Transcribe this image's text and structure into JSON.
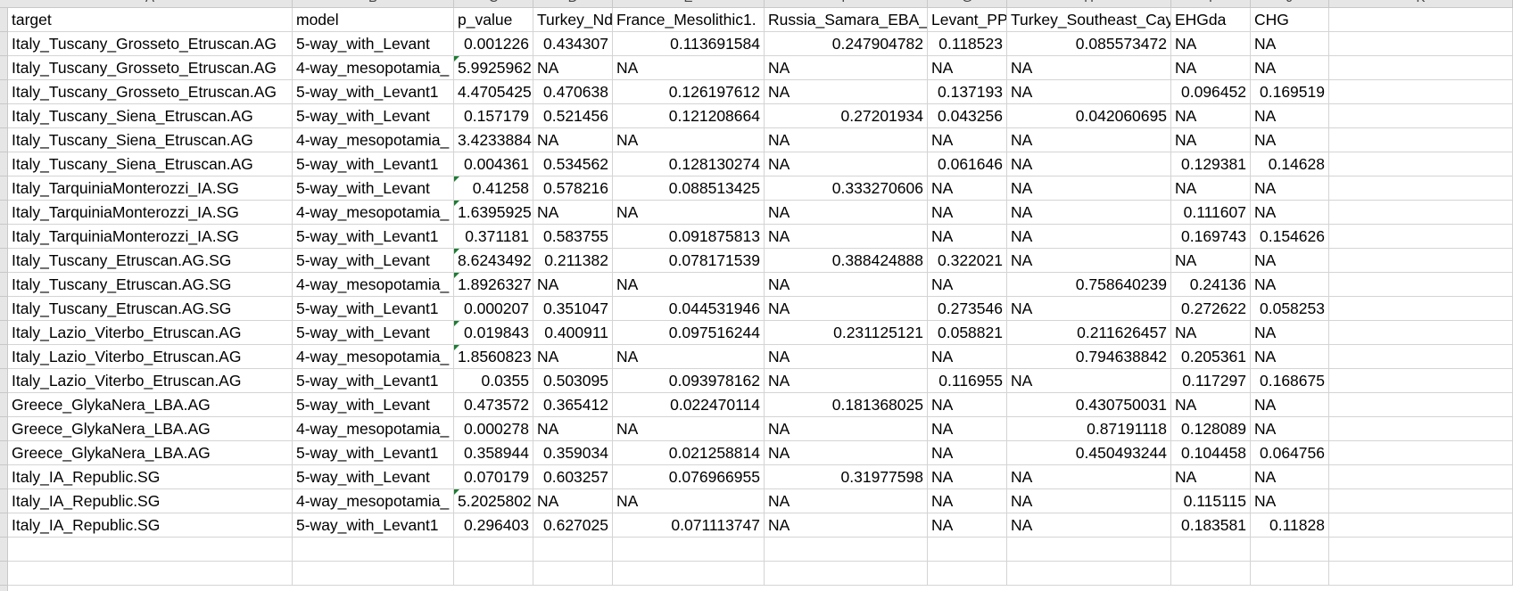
{
  "columns": [
    "A",
    "B",
    "C",
    "D",
    "E",
    "F",
    "G",
    "H",
    "I",
    "J",
    "K"
  ],
  "header_row": [
    "target",
    "model",
    "p_value",
    "Turkey_Nd",
    "France_Mesolithic1.",
    "Russia_Samara_EBA_\\",
    "Levant_PP",
    "Turkey_Southeast_Cay",
    "EHGda",
    "CHG",
    ""
  ],
  "rows": [
    [
      "Italy_Tuscany_Grosseto_Etruscan.AG",
      "5-way_with_Levant",
      "0.001226",
      "0.434307",
      "0.113691584",
      "0.247904782",
      "0.118523",
      "0.085573472",
      "NA",
      "NA"
    ],
    [
      "Italy_Tuscany_Grosseto_Etruscan.AG",
      "4-way_mesopotamia_",
      "5.9925962",
      "NA",
      "NA",
      "NA",
      "NA",
      "NA",
      "NA",
      "NA"
    ],
    [
      "Italy_Tuscany_Grosseto_Etruscan.AG",
      "5-way_with_Levant1",
      "4.4705425",
      "0.470638",
      "0.126197612",
      "NA",
      "0.137193",
      "NA",
      "0.096452",
      "0.169519"
    ],
    [
      "Italy_Tuscany_Siena_Etruscan.AG",
      "5-way_with_Levant",
      "0.157179",
      "0.521456",
      "0.121208664",
      "0.27201934",
      "0.043256",
      "0.042060695",
      "NA",
      "NA"
    ],
    [
      "Italy_Tuscany_Siena_Etruscan.AG",
      "4-way_mesopotamia_",
      "3.4233884",
      "NA",
      "NA",
      "NA",
      "NA",
      "NA",
      "NA",
      "NA"
    ],
    [
      "Italy_Tuscany_Siena_Etruscan.AG",
      "5-way_with_Levant1",
      "0.004361",
      "0.534562",
      "0.128130274",
      "NA",
      "0.061646",
      "NA",
      "0.129381",
      "0.14628"
    ],
    [
      "Italy_TarquiniaMonterozzi_IA.SG",
      "5-way_with_Levant",
      "0.41258",
      "0.578216",
      "0.088513425",
      "0.333270606",
      "NA",
      "NA",
      "NA",
      "NA"
    ],
    [
      "Italy_TarquiniaMonterozzi_IA.SG",
      "4-way_mesopotamia_",
      "1.6395925",
      "NA",
      "NA",
      "NA",
      "NA",
      "NA",
      "0.111607",
      "NA"
    ],
    [
      "Italy_TarquiniaMonterozzi_IA.SG",
      "5-way_with_Levant1",
      "0.371181",
      "0.583755",
      "0.091875813",
      "NA",
      "NA",
      "NA",
      "0.169743",
      "0.154626"
    ],
    [
      "Italy_Tuscany_Etruscan.AG.SG",
      "5-way_with_Levant",
      "8.6243492",
      "0.211382",
      "0.078171539",
      "0.388424888",
      "0.322021",
      "NA",
      "NA",
      "NA"
    ],
    [
      "Italy_Tuscany_Etruscan.AG.SG",
      "4-way_mesopotamia_",
      "1.8926327",
      "NA",
      "NA",
      "NA",
      "NA",
      "0.758640239",
      "0.24136",
      "NA"
    ],
    [
      "Italy_Tuscany_Etruscan.AG.SG",
      "5-way_with_Levant1",
      "0.000207",
      "0.351047",
      "0.044531946",
      "NA",
      "0.273546",
      "NA",
      "0.272622",
      "0.058253"
    ],
    [
      "Italy_Lazio_Viterbo_Etruscan.AG",
      "5-way_with_Levant",
      "0.019843",
      "0.400911",
      "0.097516244",
      "0.231125121",
      "0.058821",
      "0.211626457",
      "NA",
      "NA"
    ],
    [
      "Italy_Lazio_Viterbo_Etruscan.AG",
      "4-way_mesopotamia_",
      "1.8560823",
      "NA",
      "NA",
      "NA",
      "NA",
      "0.794638842",
      "0.205361",
      "NA"
    ],
    [
      "Italy_Lazio_Viterbo_Etruscan.AG",
      "5-way_with_Levant1",
      "0.0355",
      "0.503095",
      "0.093978162",
      "NA",
      "0.116955",
      "NA",
      "0.117297",
      "0.168675"
    ],
    [
      "Greece_GlykaNera_LBA.AG",
      "5-way_with_Levant",
      "0.473572",
      "0.365412",
      "0.022470114",
      "0.181368025",
      "NA",
      "0.430750031",
      "NA",
      "NA"
    ],
    [
      "Greece_GlykaNera_LBA.AG",
      "4-way_mesopotamia_",
      "0.000278",
      "NA",
      "NA",
      "NA",
      "NA",
      "0.87191118",
      "0.128089",
      "NA"
    ],
    [
      "Greece_GlykaNera_LBA.AG",
      "5-way_with_Levant1",
      "0.358944",
      "0.359034",
      "0.021258814",
      "NA",
      "NA",
      "0.450493244",
      "0.104458",
      "0.064756"
    ],
    [
      "Italy_IA_Republic.SG",
      "5-way_with_Levant",
      "0.070179",
      "0.603257",
      "0.076966955",
      "0.31977598",
      "NA",
      "NA",
      "NA",
      "NA"
    ],
    [
      "Italy_IA_Republic.SG",
      "4-way_mesopotamia_",
      "5.2025802",
      "NA",
      "NA",
      "NA",
      "NA",
      "NA",
      "0.115115",
      "NA"
    ],
    [
      "Italy_IA_Republic.SG",
      "5-way_with_Levant1",
      "0.296403",
      "0.627025",
      "0.071113747",
      "NA",
      "NA",
      "NA",
      "0.183581",
      "0.11828"
    ]
  ],
  "flagged_cells": [
    [
      1,
      2
    ],
    [
      6,
      2
    ],
    [
      7,
      2
    ],
    [
      9,
      2
    ],
    [
      10,
      2
    ],
    [
      12,
      2
    ],
    [
      13,
      2
    ],
    [
      19,
      2
    ]
  ],
  "colors": {
    "header_bg": "#e6e6e6",
    "grid": "#d4d4d4",
    "flag": "#1e7b34"
  }
}
